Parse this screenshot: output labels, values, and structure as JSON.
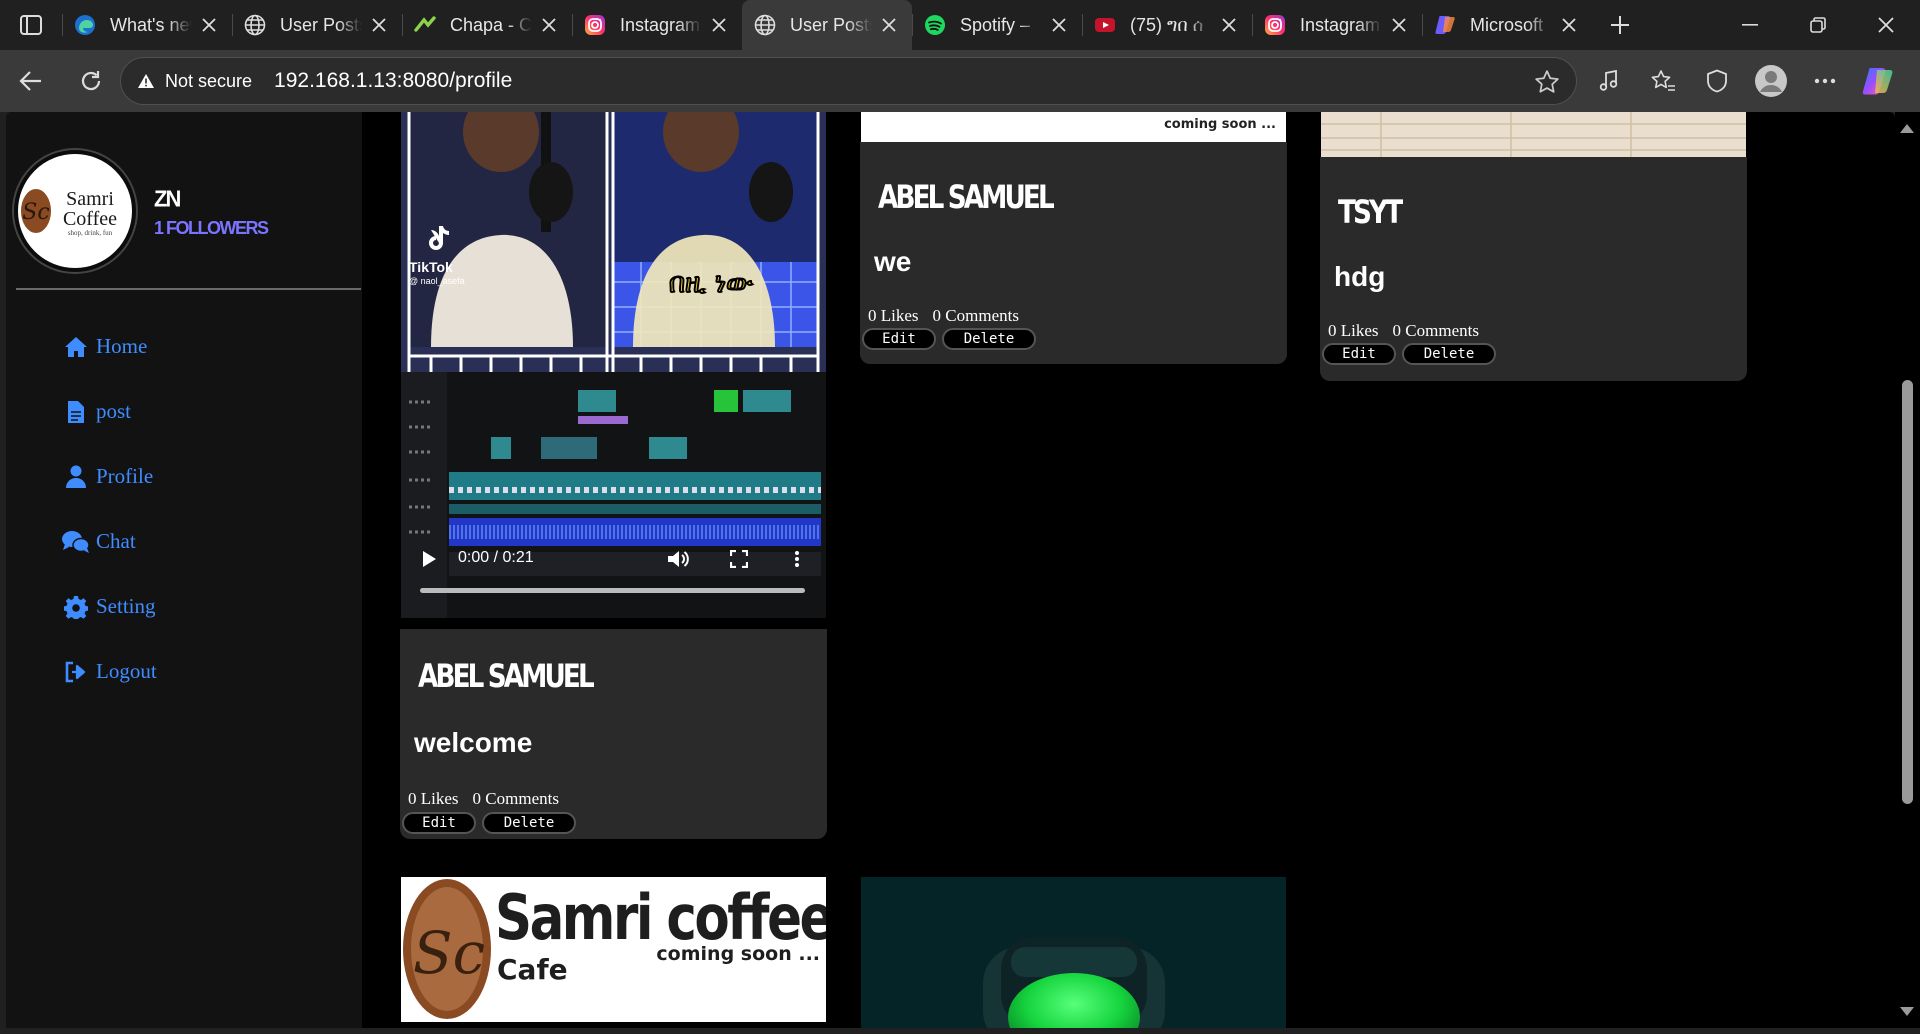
{
  "browser": {
    "tabs": [
      {
        "title": "What's new",
        "icon": "edge-icon",
        "active": false
      },
      {
        "title": "User Posts",
        "icon": "globe-icon",
        "active": false
      },
      {
        "title": "Chapa - C",
        "icon": "chapa-icon",
        "active": false
      },
      {
        "title": "Instagram",
        "icon": "instagram-icon",
        "active": false
      },
      {
        "title": "User Posts",
        "icon": "globe-icon",
        "active": true
      },
      {
        "title": "Spotify – ",
        "icon": "spotify-icon",
        "active": false
      },
      {
        "title": "(75) ግበ ሰ",
        "icon": "youtube-icon",
        "active": false
      },
      {
        "title": "Instagram",
        "icon": "instagram-icon",
        "active": false
      },
      {
        "title": "Microsoft",
        "icon": "copilot-icon",
        "active": false
      }
    ],
    "security_label": "Not secure",
    "url": "192.168.1.13:8080/profile"
  },
  "profile": {
    "logo_line1": "Samri",
    "logo_line2": "Coffee",
    "logo_tagline": "shop, drink, fun",
    "logo_monogram": "Sc",
    "username": "ZN",
    "followers": "1 FOLLOWERS"
  },
  "menu": [
    {
      "label": "Home",
      "icon": "home-icon"
    },
    {
      "label": "post",
      "icon": "file-icon"
    },
    {
      "label": "Profile",
      "icon": "user-icon"
    },
    {
      "label": "Chat",
      "icon": "chat-icon"
    },
    {
      "label": "Setting",
      "icon": "gear-icon"
    },
    {
      "label": "Logout",
      "icon": "logout-icon"
    }
  ],
  "posts": [
    {
      "author": "ABEL SAMUEL",
      "body": "welcome",
      "likes": "0 Likes",
      "comments": "0 Comments",
      "edit": "Edit",
      "delete": "Delete"
    },
    {
      "author": "ABEL SAMUEL",
      "body": "we",
      "likes": "0 Likes",
      "comments": "0 Comments",
      "edit": "Edit",
      "delete": "Delete",
      "media_caption": "coming soon ..."
    },
    {
      "author": "TSYT",
      "body": "hdg",
      "likes": "0 Likes",
      "comments": "0 Comments",
      "edit": "Edit",
      "delete": "Delete"
    }
  ],
  "video": {
    "time": "0:00 / 0:21",
    "tiktok": "TikTok",
    "tiktok_user": "@ naol_asefa",
    "caption": "በዚ ነው"
  },
  "banner": {
    "title": "Samri coffee",
    "subtitle": "coming soon ...",
    "cafe": "Cafe",
    "monogram": "Sc"
  },
  "colors": {
    "accent": "#3f8cff",
    "followers": "#7b74ff",
    "card": "#2a2a2a"
  }
}
